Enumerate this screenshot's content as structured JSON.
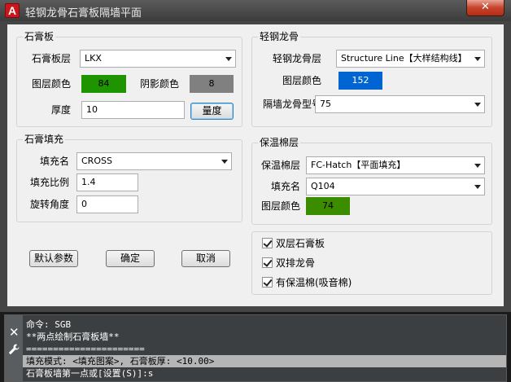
{
  "window": {
    "app_icon_letter": "A",
    "title": "轻钢龙骨石膏板隔墙平面",
    "close_glyph": "✕"
  },
  "gypsum": {
    "legend": "石膏板",
    "layer_label": "石膏板层",
    "layer_value": "LKX",
    "layer_color_label": "图层颜色",
    "layer_color_value": "84",
    "layer_color_hex": "#1e9400",
    "shadow_color_label": "阴影颜色",
    "shadow_color_value": "8",
    "shadow_color_hex": "#808080",
    "thickness_label": "厚度",
    "thickness_value": "10",
    "measure_button": "量度"
  },
  "keel": {
    "legend": "轻钢龙骨",
    "layer_label": "轻钢龙骨层",
    "layer_value": "Structure Line【大样结构线】",
    "layer_color_label": "图层颜色",
    "layer_color_value": "152",
    "layer_color_hex": "#0064d2",
    "model_label": "隔墙龙骨型号",
    "model_value": "75"
  },
  "fill": {
    "legend": "石膏填充",
    "name_label": "填充名",
    "name_value": "CROSS",
    "scale_label": "填充比例",
    "scale_value": "1.4",
    "angle_label": "旋转角度",
    "angle_value": "0"
  },
  "insulation": {
    "legend": "保温棉层",
    "layer_label": "保温棉层",
    "layer_value": "FC-Hatch【平面填充】",
    "fill_label": "填充名",
    "fill_value": "Q104",
    "layer_color_label": "图层颜色",
    "layer_color_value": "74",
    "layer_color_hex": "#3c8c00"
  },
  "buttons": {
    "default": "默认参数",
    "ok": "确定",
    "cancel": "取消"
  },
  "options": {
    "double_gypsum": "双层石膏板",
    "double_keel": "双排龙骨",
    "with_insulation": "有保温棉(吸音棉)"
  },
  "command": {
    "close_glyph": "✕",
    "history": [
      "命令: SGB",
      "**两点绘制石膏板墙**",
      "======================"
    ],
    "lines": [
      "填充模式: <填充图案>, 石膏板厚: <10.00>",
      "石膏板墙第一点或[设置(S)]:s"
    ]
  }
}
